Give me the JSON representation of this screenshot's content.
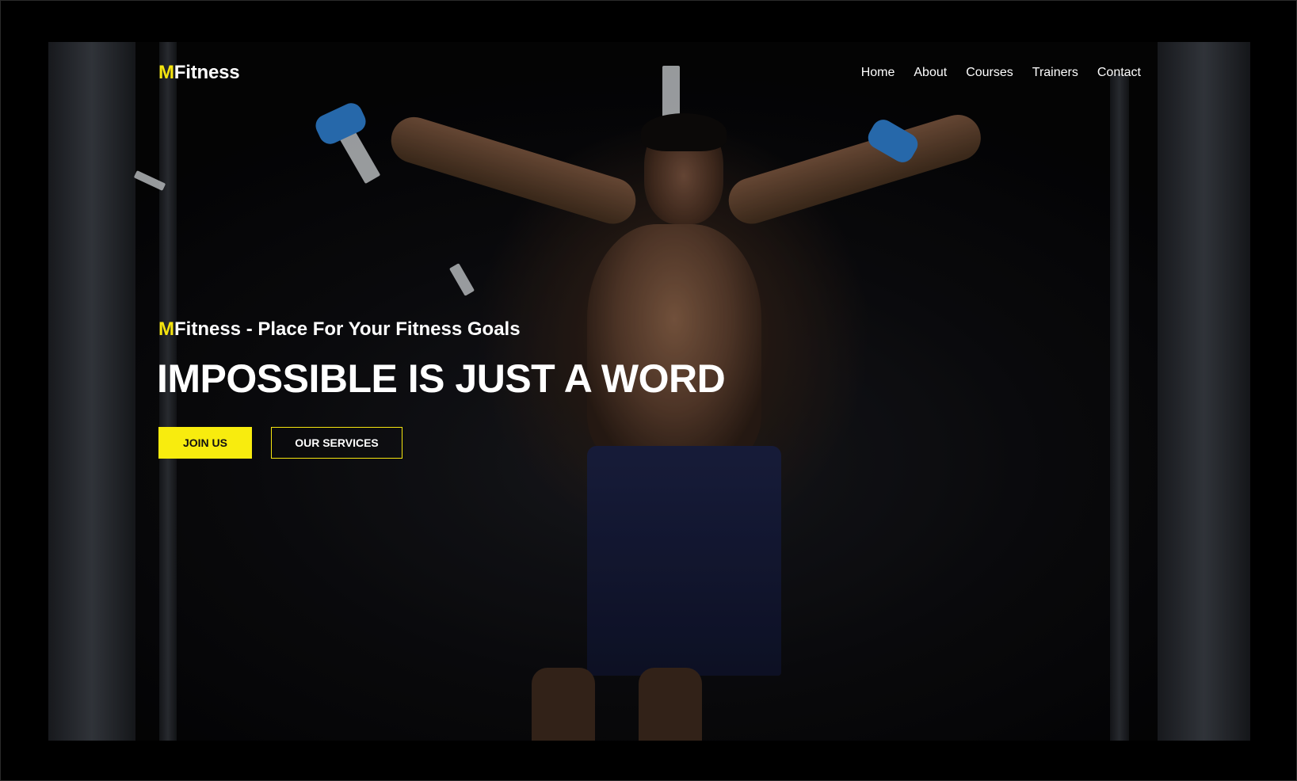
{
  "brand": {
    "logo_accent": "M",
    "logo_rest": "Fitness"
  },
  "nav": {
    "items": [
      {
        "label": "Home"
      },
      {
        "label": "About"
      },
      {
        "label": "Courses"
      },
      {
        "label": "Trainers"
      },
      {
        "label": "Contact"
      }
    ]
  },
  "hero": {
    "tagline_accent": "M",
    "tagline_rest": "Fitness - Place For Your Fitness Goals",
    "headline": "IMPOSSIBLE IS JUST A WORD",
    "join_label": "JOIN US",
    "services_label": "OUR SERVICES",
    "background_subject": "muscular man exercising on cable machine in dark gym"
  },
  "colors": {
    "accent": "#f5e50f",
    "background": "#000000",
    "text": "#ffffff"
  }
}
